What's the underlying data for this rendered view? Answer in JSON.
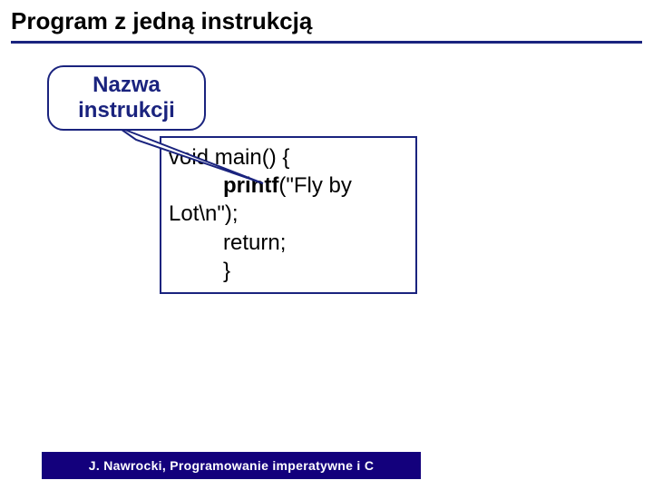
{
  "title": "Program z jedną instrukcją",
  "callout": {
    "label": "Nazwa instrukcji"
  },
  "code": {
    "line1_pre": "void main() {",
    "line2_indent": "         ",
    "line2_kw": "printf",
    "line2_post": "(\"Fly by",
    "line3": "Lot\\n\");",
    "line4_indent": "         ",
    "line4": "return;",
    "line5_indent": "         ",
    "line5": "}"
  },
  "footer": "J. Nawrocki, Programowanie imperatywne i C"
}
